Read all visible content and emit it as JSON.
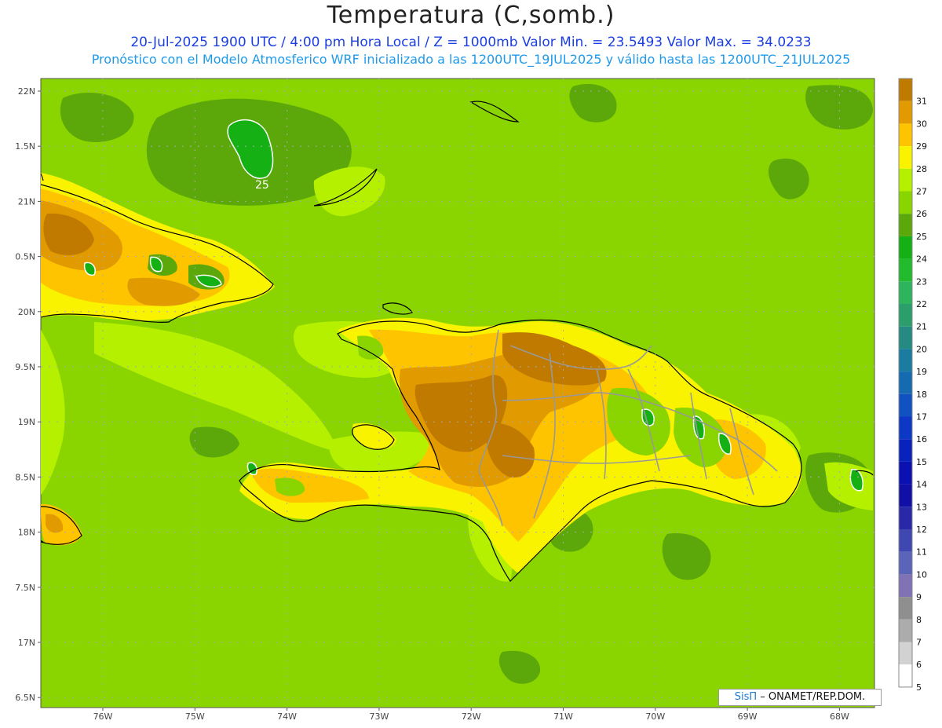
{
  "title": "Temperatura (C,somb.)",
  "subtitle_line1": "20-Jul-2025  1900 UTC / 4:00 pm Hora Local / Z = 1000mb   Valor Min. = 23.5493  Valor Max. = 34.0233",
  "subtitle_line2": "Pronóstico con el Modelo Atmosferico WRF inicializado a las 1200UTC_19JUL2025 y válido hasta las  1200UTC_21JUL2025",
  "credit": {
    "brand": "SisΠ",
    "org": " – ONAMET/REP.DOM."
  },
  "lat_ticks": [
    "22N",
    "1.5N",
    "21N",
    "0.5N",
    "20N",
    "9.5N",
    "19N",
    "8.5N",
    "18N",
    "7.5N",
    "17N",
    "6.5N"
  ],
  "lon_ticks": [
    "76W",
    "75W",
    "74W",
    "73W",
    "72W",
    "71W",
    "70W",
    "69W",
    "68W"
  ],
  "contour_label": "25",
  "colorbar": {
    "labels": [
      "31",
      "30",
      "29",
      "28",
      "27",
      "26",
      "25",
      "24",
      "23",
      "22",
      "21",
      "20",
      "19",
      "18",
      "17",
      "16",
      "15",
      "14",
      "13",
      "12",
      "11",
      "10",
      "9",
      "8",
      "7",
      "6",
      "5"
    ],
    "colors": [
      "#c07a00",
      "#e19a00",
      "#ffc400",
      "#f9f300",
      "#b5f000",
      "#8ad400",
      "#5ca80b",
      "#14b014",
      "#22bb2e",
      "#2fb45e",
      "#2c9e6c",
      "#248a82",
      "#1a7da0",
      "#166ab0",
      "#1251c2",
      "#0d38c6",
      "#0a22bc",
      "#0b10b0",
      "#1010a6",
      "#2828a8",
      "#3e48b0",
      "#5a64b8",
      "#8072b4",
      "#8f8f8f",
      "#acacac",
      "#d2d2d2",
      "#ffffff"
    ]
  },
  "colors": {
    "sea": "#8ad400",
    "warm_sea": "#b5f000",
    "cool_sea": "#5ca80b",
    "land_28": "#f9f300",
    "land_29": "#ffc400",
    "land_30": "#e19a00",
    "land_31": "#c07a00",
    "green_24": "#14b014"
  }
}
